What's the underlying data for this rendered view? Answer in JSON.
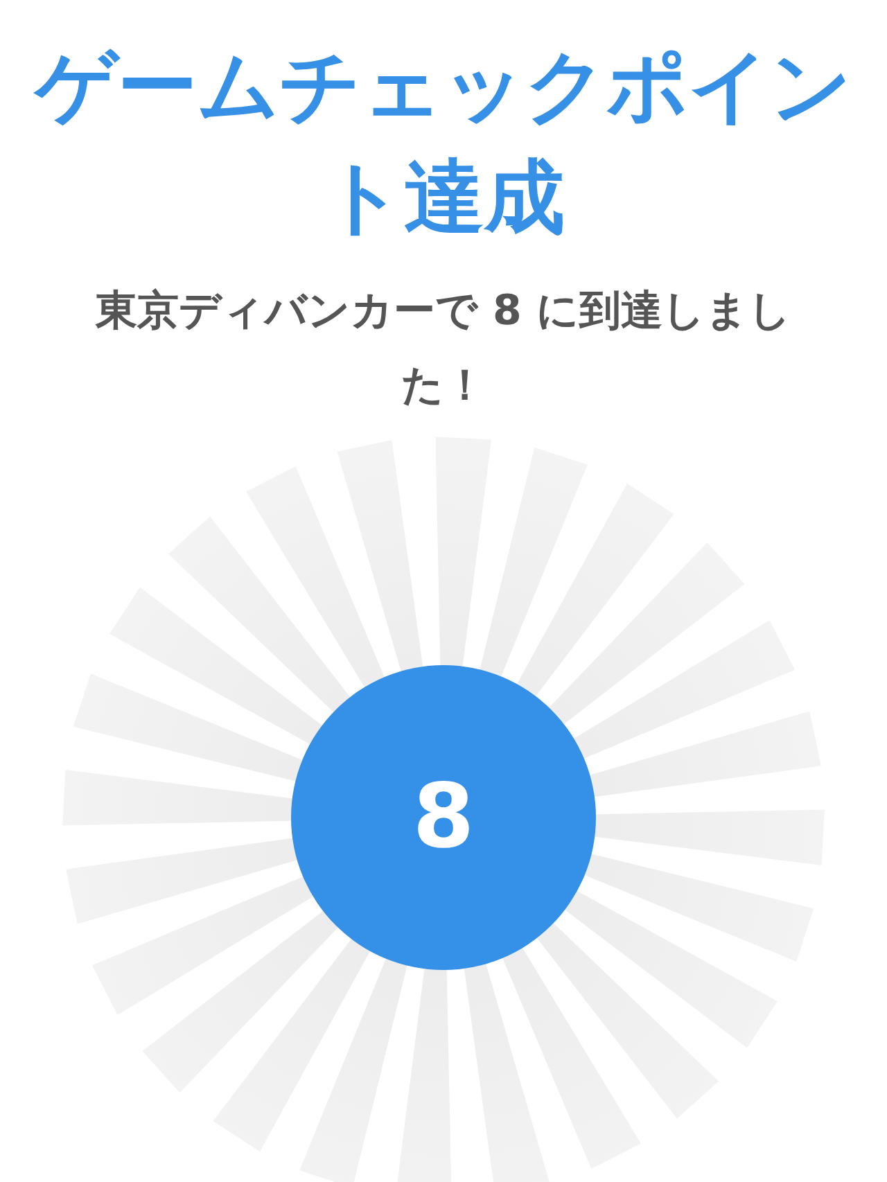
{
  "title": "ゲームチェックポイント達成",
  "message": "東京ディバンカーで 8 に到達しました！",
  "badge": "8"
}
